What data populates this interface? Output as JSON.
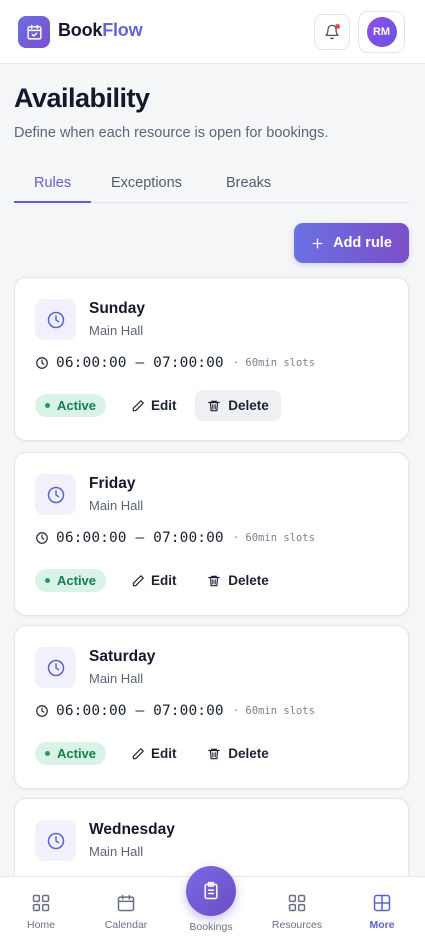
{
  "app": {
    "brand_part1": "Book",
    "brand_part2": "Flow",
    "avatar_initials": "RM",
    "accent_color": "#5b62cf",
    "notification_dot_color": "#ef4444"
  },
  "page": {
    "title": "Availability",
    "subtitle": "Define when each resource is open for bookings."
  },
  "tabs": [
    {
      "label": "Rules",
      "active": true
    },
    {
      "label": "Exceptions",
      "active": false
    },
    {
      "label": "Breaks",
      "active": false
    }
  ],
  "add_rule_label": "Add rule",
  "rules": [
    {
      "day": "Sunday",
      "location": "Main Hall",
      "time": "06:00:00 – 07:00:00",
      "slots": "· 60min slots",
      "status": "Active",
      "edit": "Edit",
      "delete": "Delete",
      "icon": "clock-icon"
    },
    {
      "day": "Friday",
      "location": "Main Hall",
      "time": "06:00:00 – 07:00:00",
      "slots": "· 60min slots",
      "status": "Active",
      "edit": "Edit",
      "delete": "Delete",
      "icon": "clock-icon"
    },
    {
      "day": "Saturday",
      "location": "Main Hall",
      "time": "06:00:00 – 07:00:00",
      "slots": "· 60min slots",
      "status": "Active",
      "edit": "Edit",
      "delete": "Delete",
      "icon": "clock-icon"
    },
    {
      "day": "Wednesday",
      "location": "Main Hall",
      "icon": "clock-icon"
    }
  ],
  "nav": {
    "home": "Home",
    "calendar": "Calendar",
    "bookings": "Bookings",
    "resources": "Resources",
    "more": "More",
    "active": "more"
  }
}
